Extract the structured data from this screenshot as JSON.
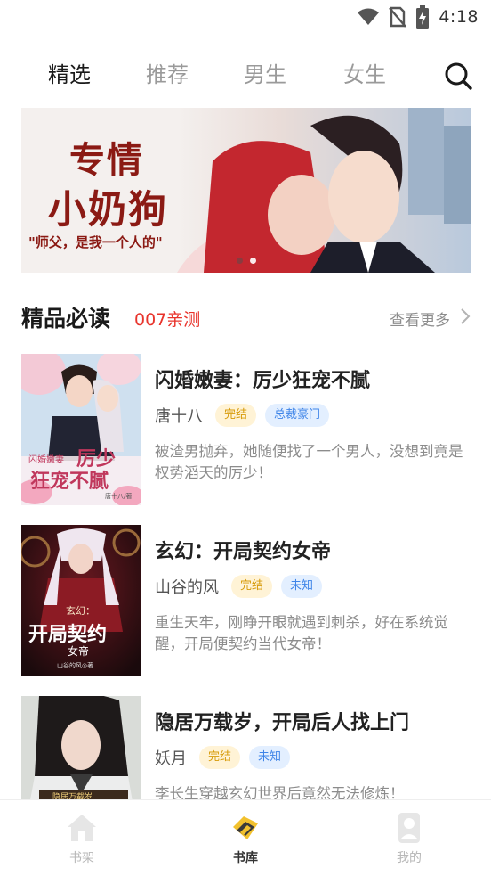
{
  "status_bar": {
    "time": "4:18"
  },
  "tabs": [
    {
      "label": "精选",
      "active": true
    },
    {
      "label": "推荐",
      "active": false
    },
    {
      "label": "男生",
      "active": false
    },
    {
      "label": "女生",
      "active": false
    }
  ],
  "banner": {
    "title_line1": "专情",
    "title_line2": "小奶狗",
    "subtitle": "\"师父，是我一个人的\""
  },
  "section": {
    "title": "精品必读",
    "tag": "007亲测",
    "more": "查看更多"
  },
  "books": [
    {
      "title": "闪婚嫩妻：厉少狂宠不腻",
      "author": "唐十八",
      "status": "完结",
      "genre": "总裁豪门",
      "desc": "被渣男抛弃，她随便找了一个男人，没想到竟是权势滔天的厉少！",
      "cover_text": [
        "闪婚嫩妻",
        "厉少",
        "狂宠不腻",
        "唐十八/著"
      ]
    },
    {
      "title": "玄幻：开局契约女帝",
      "author": "山谷的风",
      "status": "完结",
      "genre": "未知",
      "desc": "重生天牢，刚睁开眼就遇到刺杀，好在系统觉醒，开局便契约当代女帝！",
      "cover_text": [
        "玄幻：",
        "开局契约",
        "女帝",
        "山谷的风◎著"
      ]
    },
    {
      "title": "隐居万载岁，开局后人找上门",
      "author": "妖月",
      "status": "完结",
      "genre": "未知",
      "desc": "李长生穿越玄幻世界后竟然无法修炼！",
      "cover_text": [
        "隐居万载岁"
      ]
    }
  ],
  "bottom_nav": [
    {
      "label": "书架",
      "active": false
    },
    {
      "label": "书库",
      "active": true
    },
    {
      "label": "我的",
      "active": false
    }
  ],
  "colors": {
    "accent_red": "#e8332b",
    "tag_yellow": "#d79b0a",
    "tag_blue": "#3e84e8",
    "nav_active": "#f2c12e"
  }
}
